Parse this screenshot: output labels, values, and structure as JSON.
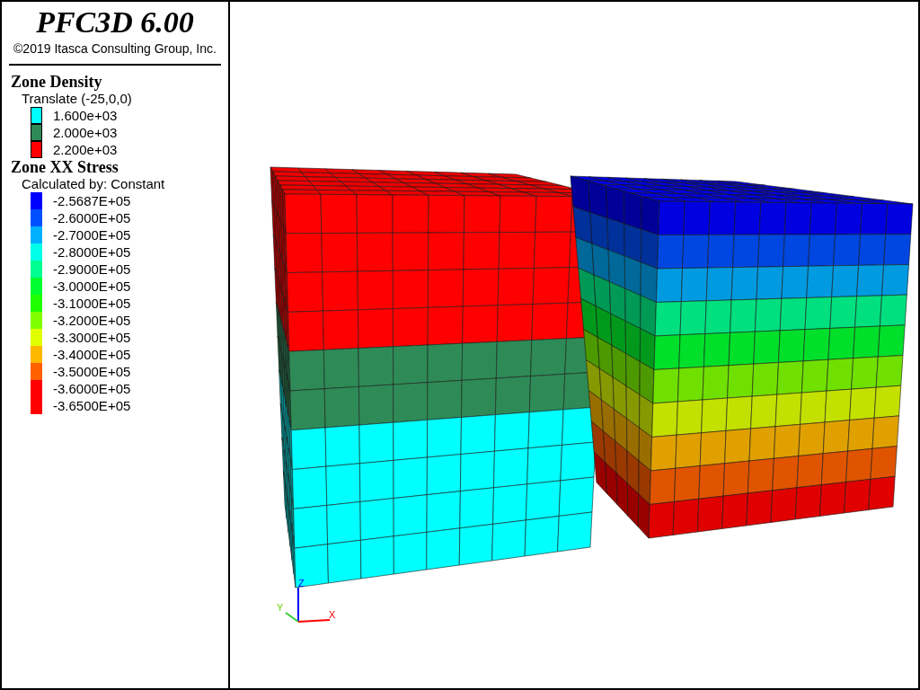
{
  "title": "PFC3D 6.00",
  "copyright": "©2019 Itasca Consulting Group, Inc.",
  "legends": [
    {
      "heading": "Zone Density",
      "subtitle": "Translate (-25,0,0)",
      "items": [
        {
          "label": "1.600e+03",
          "color": "#00ffff"
        },
        {
          "label": "2.000e+03",
          "color": "#2e8b57"
        },
        {
          "label": "2.200e+03",
          "color": "#ff0000"
        }
      ]
    },
    {
      "heading": "Zone XX Stress",
      "subtitle": "Calculated by: Constant",
      "items": [
        {
          "label": "-2.5687E+05",
          "color": "#0000ff"
        },
        {
          "label": "-2.6000E+05",
          "color": "#0050ff"
        },
        {
          "label": "-2.7000E+05",
          "color": "#00b0ff"
        },
        {
          "label": "-2.8000E+05",
          "color": "#00ffe8"
        },
        {
          "label": "-2.9000E+05",
          "color": "#00ff90"
        },
        {
          "label": "-3.0000E+05",
          "color": "#00ff30"
        },
        {
          "label": "-3.1000E+05",
          "color": "#20ff00"
        },
        {
          "label": "-3.2000E+05",
          "color": "#80ff00"
        },
        {
          "label": "-3.3000E+05",
          "color": "#e0ff00"
        },
        {
          "label": "-3.4000E+05",
          "color": "#ffb800"
        },
        {
          "label": "-3.5000E+05",
          "color": "#ff6000"
        },
        {
          "label": "-3.6000E+05",
          "color": "#ff0000"
        },
        {
          "label": "-3.6500E+05",
          "color": "#ff0000"
        }
      ]
    }
  ],
  "axes": {
    "x": "X",
    "y": "Y",
    "z": "Z"
  }
}
